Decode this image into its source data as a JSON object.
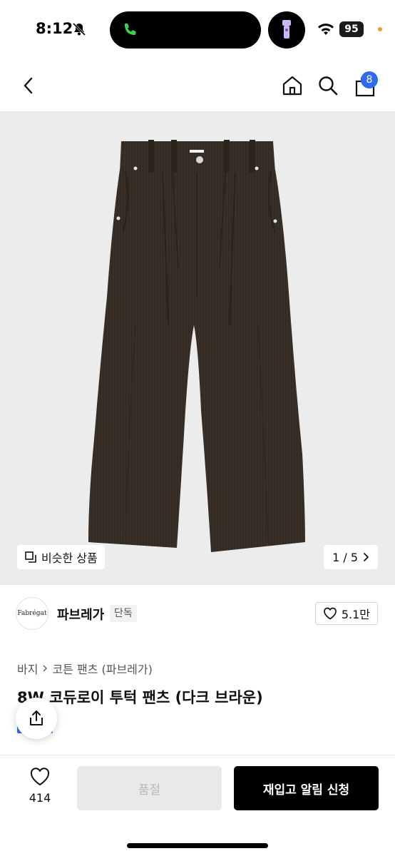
{
  "status_bar": {
    "time": "8:12",
    "battery": "95",
    "icons": [
      "bell-slash-icon",
      "phone-icon",
      "flashlight-icon",
      "wifi-icon"
    ]
  },
  "nav": {
    "icons": [
      "back-chevron-icon",
      "home-icon",
      "search-icon",
      "bag-icon"
    ],
    "cart_count": "8"
  },
  "hero": {
    "similar_label": "비슷한 상품",
    "page_indicator": "1 / 5",
    "image_alt": "dark brown corduroy tuck pants"
  },
  "brand": {
    "logo_text": "Fabrégat",
    "name": "파브레가",
    "tag": "단독",
    "likes": "5.1만"
  },
  "product": {
    "breadcrumb": [
      "바지",
      "코튼 팬츠 (파브레가)"
    ],
    "title": "8W 코듀로이 투턱 팬츠 (다크 브라운)"
  },
  "bottom_bar": {
    "wish_count": "414",
    "soldout_label": "품절",
    "restock_label": "재입고 알림 신청"
  },
  "colors": {
    "accent_blue": "#2f6bf0",
    "pants_brown": "#3a302a",
    "hero_bg": "#ececec"
  }
}
